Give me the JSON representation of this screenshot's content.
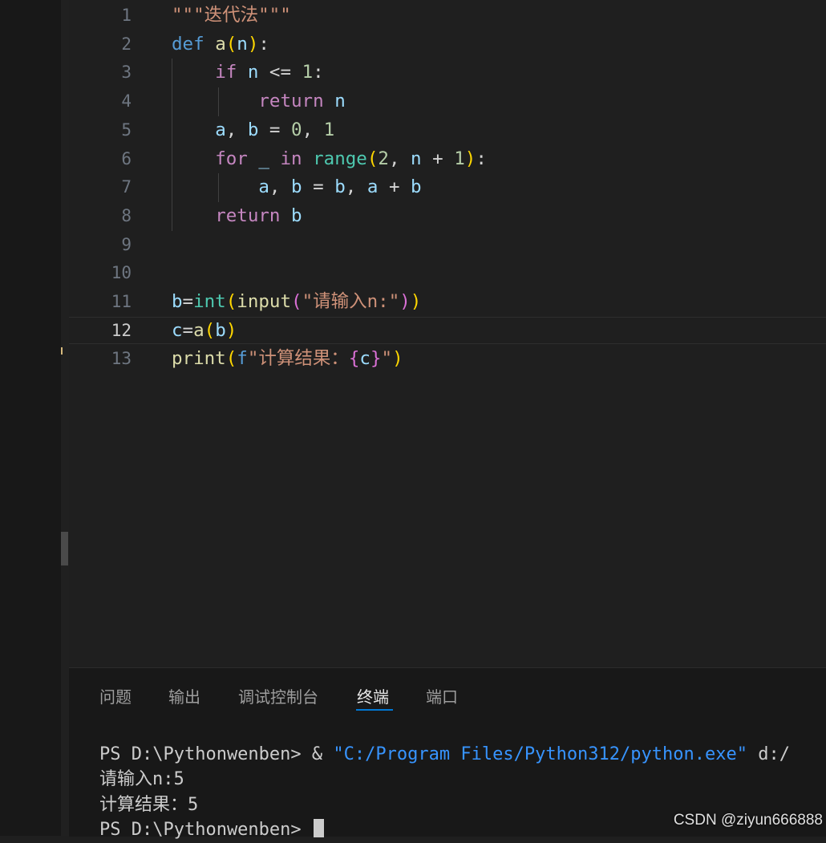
{
  "editor": {
    "line_numbers": [
      "1",
      "2",
      "3",
      "4",
      "5",
      "6",
      "7",
      "8",
      "9",
      "10",
      "11",
      "12",
      "13"
    ],
    "active_line": "12",
    "lines": {
      "l1": {
        "str": "\"\"\"迭代法\"\"\""
      },
      "l2": {
        "def": "def",
        "fname": "a",
        "lp": "(",
        "param": "n",
        "rp": ")",
        "colon": ":"
      },
      "l3": {
        "kw": "if",
        "var": "n",
        "op": "<=",
        "num": "1",
        "colon": ":"
      },
      "l4": {
        "kw": "return",
        "var": "n"
      },
      "l5": {
        "v1": "a",
        "comma": ",",
        "v2": "b",
        "eq": "=",
        "n1": "0",
        "comma2": ",",
        "n2": "1"
      },
      "l6": {
        "kw": "for",
        "under": "_",
        "in": "in",
        "fn": "range",
        "lp": "(",
        "n1": "2",
        "comma": ",",
        "var": "n",
        "plus": "+",
        "n2": "1",
        "rp": ")",
        "colon": ":"
      },
      "l7": {
        "v1": "a",
        "comma": ",",
        "v2": "b",
        "eq": "=",
        "v3": "b",
        "comma2": ",",
        "v4": "a",
        "plus": "+",
        "v5": "b"
      },
      "l8": {
        "kw": "return",
        "var": "b"
      },
      "l11": {
        "var": "b",
        "eq": "=",
        "typ": "int",
        "lp": "(",
        "fn": "input",
        "lp2": "(",
        "str": "\"请输入n:\"",
        "rp2": ")",
        "rp": ")"
      },
      "l12": {
        "var": "c",
        "eq": "=",
        "fn": "a",
        "lp": "(",
        "arg": "b",
        "rp": ")"
      },
      "l13": {
        "fn": "print",
        "lp": "(",
        "fprefix": "f",
        "str": "\"计算结果：",
        "lb": "{",
        "var": "c",
        "rb": "}",
        "str2": "\"",
        "rp": ")"
      }
    }
  },
  "panel": {
    "tabs": [
      "问题",
      "输出",
      "调试控制台",
      "终端",
      "端口"
    ],
    "active_tab": "终端"
  },
  "terminal": {
    "line1_prompt": "PS D:\\Pythonwenben>",
    "line1_amp": "&",
    "line1_exe": "\"C:/Program Files/Python312/python.exe\"",
    "line1_tail": "d:/",
    "line2": "请输入n:5",
    "line3": "计算结果：5",
    "line4_prompt": "PS D:\\Pythonwenben>"
  },
  "watermark": "CSDN @ziyun666888"
}
